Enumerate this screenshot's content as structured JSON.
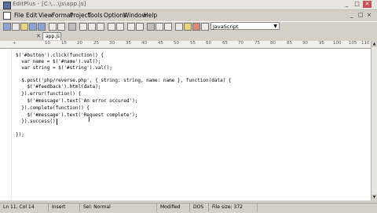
{
  "window": {
    "title": "EditPlus - [C:\\...\\js\\app.js]",
    "controls": [
      "_",
      "□",
      "✕"
    ]
  },
  "menubar": {
    "items": [
      "File",
      "Edit",
      "View",
      "Format",
      "Project",
      "Tools",
      "Options",
      "Window",
      "Help"
    ],
    "mdi_controls": [
      "_",
      "□",
      "×"
    ]
  },
  "toolbar": {
    "language": "JavaScript"
  },
  "tabs": [
    {
      "label": "app.js",
      "active": true
    }
  ],
  "ruler": {
    "labels": [
      "+",
      "10",
      "15",
      "20",
      "25",
      "30",
      "35",
      "40",
      "45",
      "50",
      "55",
      "60",
      "65",
      "70",
      "75",
      "80",
      "85",
      "90",
      "95",
      "100",
      "105",
      "110"
    ]
  },
  "code": {
    "lines": [
      "$('#button').click(function() {",
      "  var name = $('#name').val();",
      "  var string = $('#string').val();",
      "",
      "  $.post('php/reverse.php', { string: string, name: name }, function(data) {",
      "    $('#feedback').html(data);",
      "  }).error(function() {",
      "    $('#message').text('An error occured');",
      "  }).complete(function() {",
      "    $('#message').text('Request complete');",
      "  }).success();",
      "",
      "});"
    ]
  },
  "statusbar": {
    "position": "Ln 11, Col 14",
    "insert": "Insert",
    "selection": "Sel: Normal",
    "modified": "Modified",
    "lineend": "DOS",
    "filesize": "File size: 372"
  }
}
